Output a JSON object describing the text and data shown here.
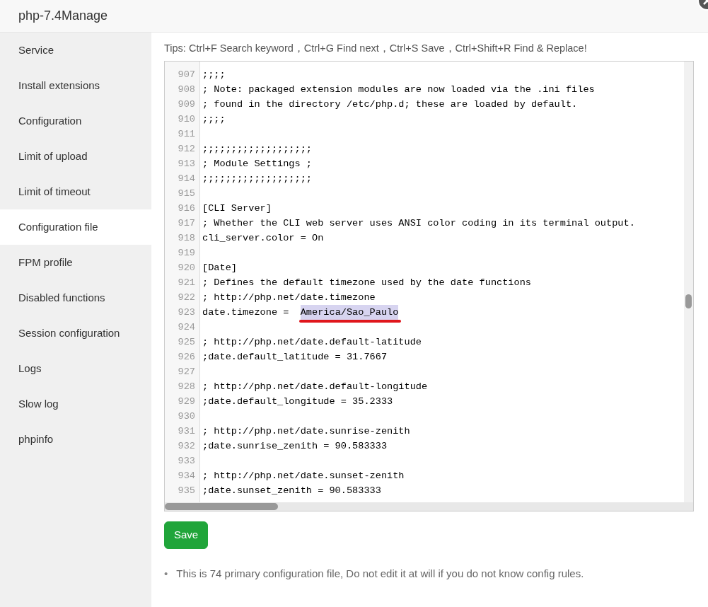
{
  "window": {
    "title": "php-7.4Manage"
  },
  "sidebar": {
    "items": [
      {
        "label": "Service",
        "selected": false
      },
      {
        "label": "Install extensions",
        "selected": false
      },
      {
        "label": "Configuration",
        "selected": false
      },
      {
        "label": "Limit of upload",
        "selected": false
      },
      {
        "label": "Limit of timeout",
        "selected": false
      },
      {
        "label": "Configuration file",
        "selected": true
      },
      {
        "label": "FPM profile",
        "selected": false
      },
      {
        "label": "Disabled functions",
        "selected": false
      },
      {
        "label": "Session configuration",
        "selected": false
      },
      {
        "label": "Logs",
        "selected": false
      },
      {
        "label": "Slow log",
        "selected": false
      },
      {
        "label": "phpinfo",
        "selected": false
      }
    ]
  },
  "tips": "Tips: Ctrl+F Search keyword，Ctrl+G Find next，Ctrl+S Save，Ctrl+Shift+R Find & Replace!",
  "editor": {
    "lines": [
      {
        "number": "907",
        "text": ";;;;"
      },
      {
        "number": "908",
        "text": "; Note: packaged extension modules are now loaded via the .ini files"
      },
      {
        "number": "909",
        "text": "; found in the directory /etc/php.d; these are loaded by default."
      },
      {
        "number": "910",
        "text": ";;;;"
      },
      {
        "number": "911"
      },
      {
        "number": "912",
        "text": ";;;;;;;;;;;;;;;;;;;"
      },
      {
        "number": "913",
        "text": "; Module Settings ;"
      },
      {
        "number": "914",
        "text": ";;;;;;;;;;;;;;;;;;;"
      },
      {
        "number": "915"
      },
      {
        "number": "916",
        "text": "[CLI Server]"
      },
      {
        "number": "917",
        "text": "; Whether the CLI web server uses ANSI color coding in its terminal output."
      },
      {
        "number": "918",
        "text": "cli_server.color = On"
      },
      {
        "number": "919"
      },
      {
        "number": "920",
        "text": "[Date]"
      },
      {
        "number": "921",
        "text": "; Defines the default timezone used by the date functions"
      },
      {
        "number": "922",
        "text": "; http://php.net/date.timezone"
      },
      {
        "number": "923",
        "text": "date.timezone =  ",
        "selected_text": "America/Sao_Paulo",
        "underlined": true
      },
      {
        "number": "924"
      },
      {
        "number": "925",
        "text": "; http://php.net/date.default-latitude"
      },
      {
        "number": "926",
        "text": ";date.default_latitude = 31.7667"
      },
      {
        "number": "927"
      },
      {
        "number": "928",
        "text": "; http://php.net/date.default-longitude"
      },
      {
        "number": "929",
        "text": ";date.default_longitude = 35.2333"
      },
      {
        "number": "930"
      },
      {
        "number": "931",
        "text": "; http://php.net/date.sunrise-zenith"
      },
      {
        "number": "932",
        "text": ";date.sunrise_zenith = 90.583333"
      },
      {
        "number": "933"
      },
      {
        "number": "934",
        "text": "; http://php.net/date.sunset-zenith"
      },
      {
        "number": "935",
        "text": ";date.sunset_zenith = 90.583333"
      }
    ]
  },
  "save_button": "Save",
  "notes": [
    {
      "bullet": "•",
      "text": "This is 74 primary configuration file, Do not edit it at will if you do not know config rules."
    }
  ]
}
